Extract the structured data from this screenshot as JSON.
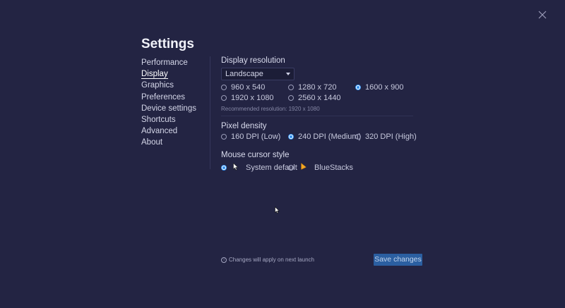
{
  "window": {
    "title": "Settings"
  },
  "nav": {
    "items": [
      {
        "label": "Performance"
      },
      {
        "label": "Display"
      },
      {
        "label": "Graphics"
      },
      {
        "label": "Preferences"
      },
      {
        "label": "Device settings"
      },
      {
        "label": "Shortcuts"
      },
      {
        "label": "Advanced"
      },
      {
        "label": "About"
      }
    ],
    "active": "Display"
  },
  "display_resolution": {
    "label": "Display resolution",
    "orientation": "Landscape",
    "options": [
      "960 x 540",
      "1280 x 720",
      "1600 x 900",
      "1920 x 1080",
      "2560 x 1440"
    ],
    "selected": "1600 x 900",
    "recommended": "Recommended resolution: 1920 x 1080"
  },
  "pixel_density": {
    "label": "Pixel density",
    "options": [
      "160 DPI (Low)",
      "240 DPI (Medium)",
      "320 DPI (High)"
    ],
    "selected": "240 DPI (Medium)"
  },
  "cursor_style": {
    "label": "Mouse cursor style",
    "options": [
      "System default",
      "BlueStacks"
    ],
    "selected": "System default"
  },
  "footer": {
    "note": "Changes will apply on next launch",
    "save_label": "Save changes"
  },
  "colors": {
    "accent": "#2f8ff0",
    "save_bg": "#2b5fa1",
    "background": "#232443"
  }
}
